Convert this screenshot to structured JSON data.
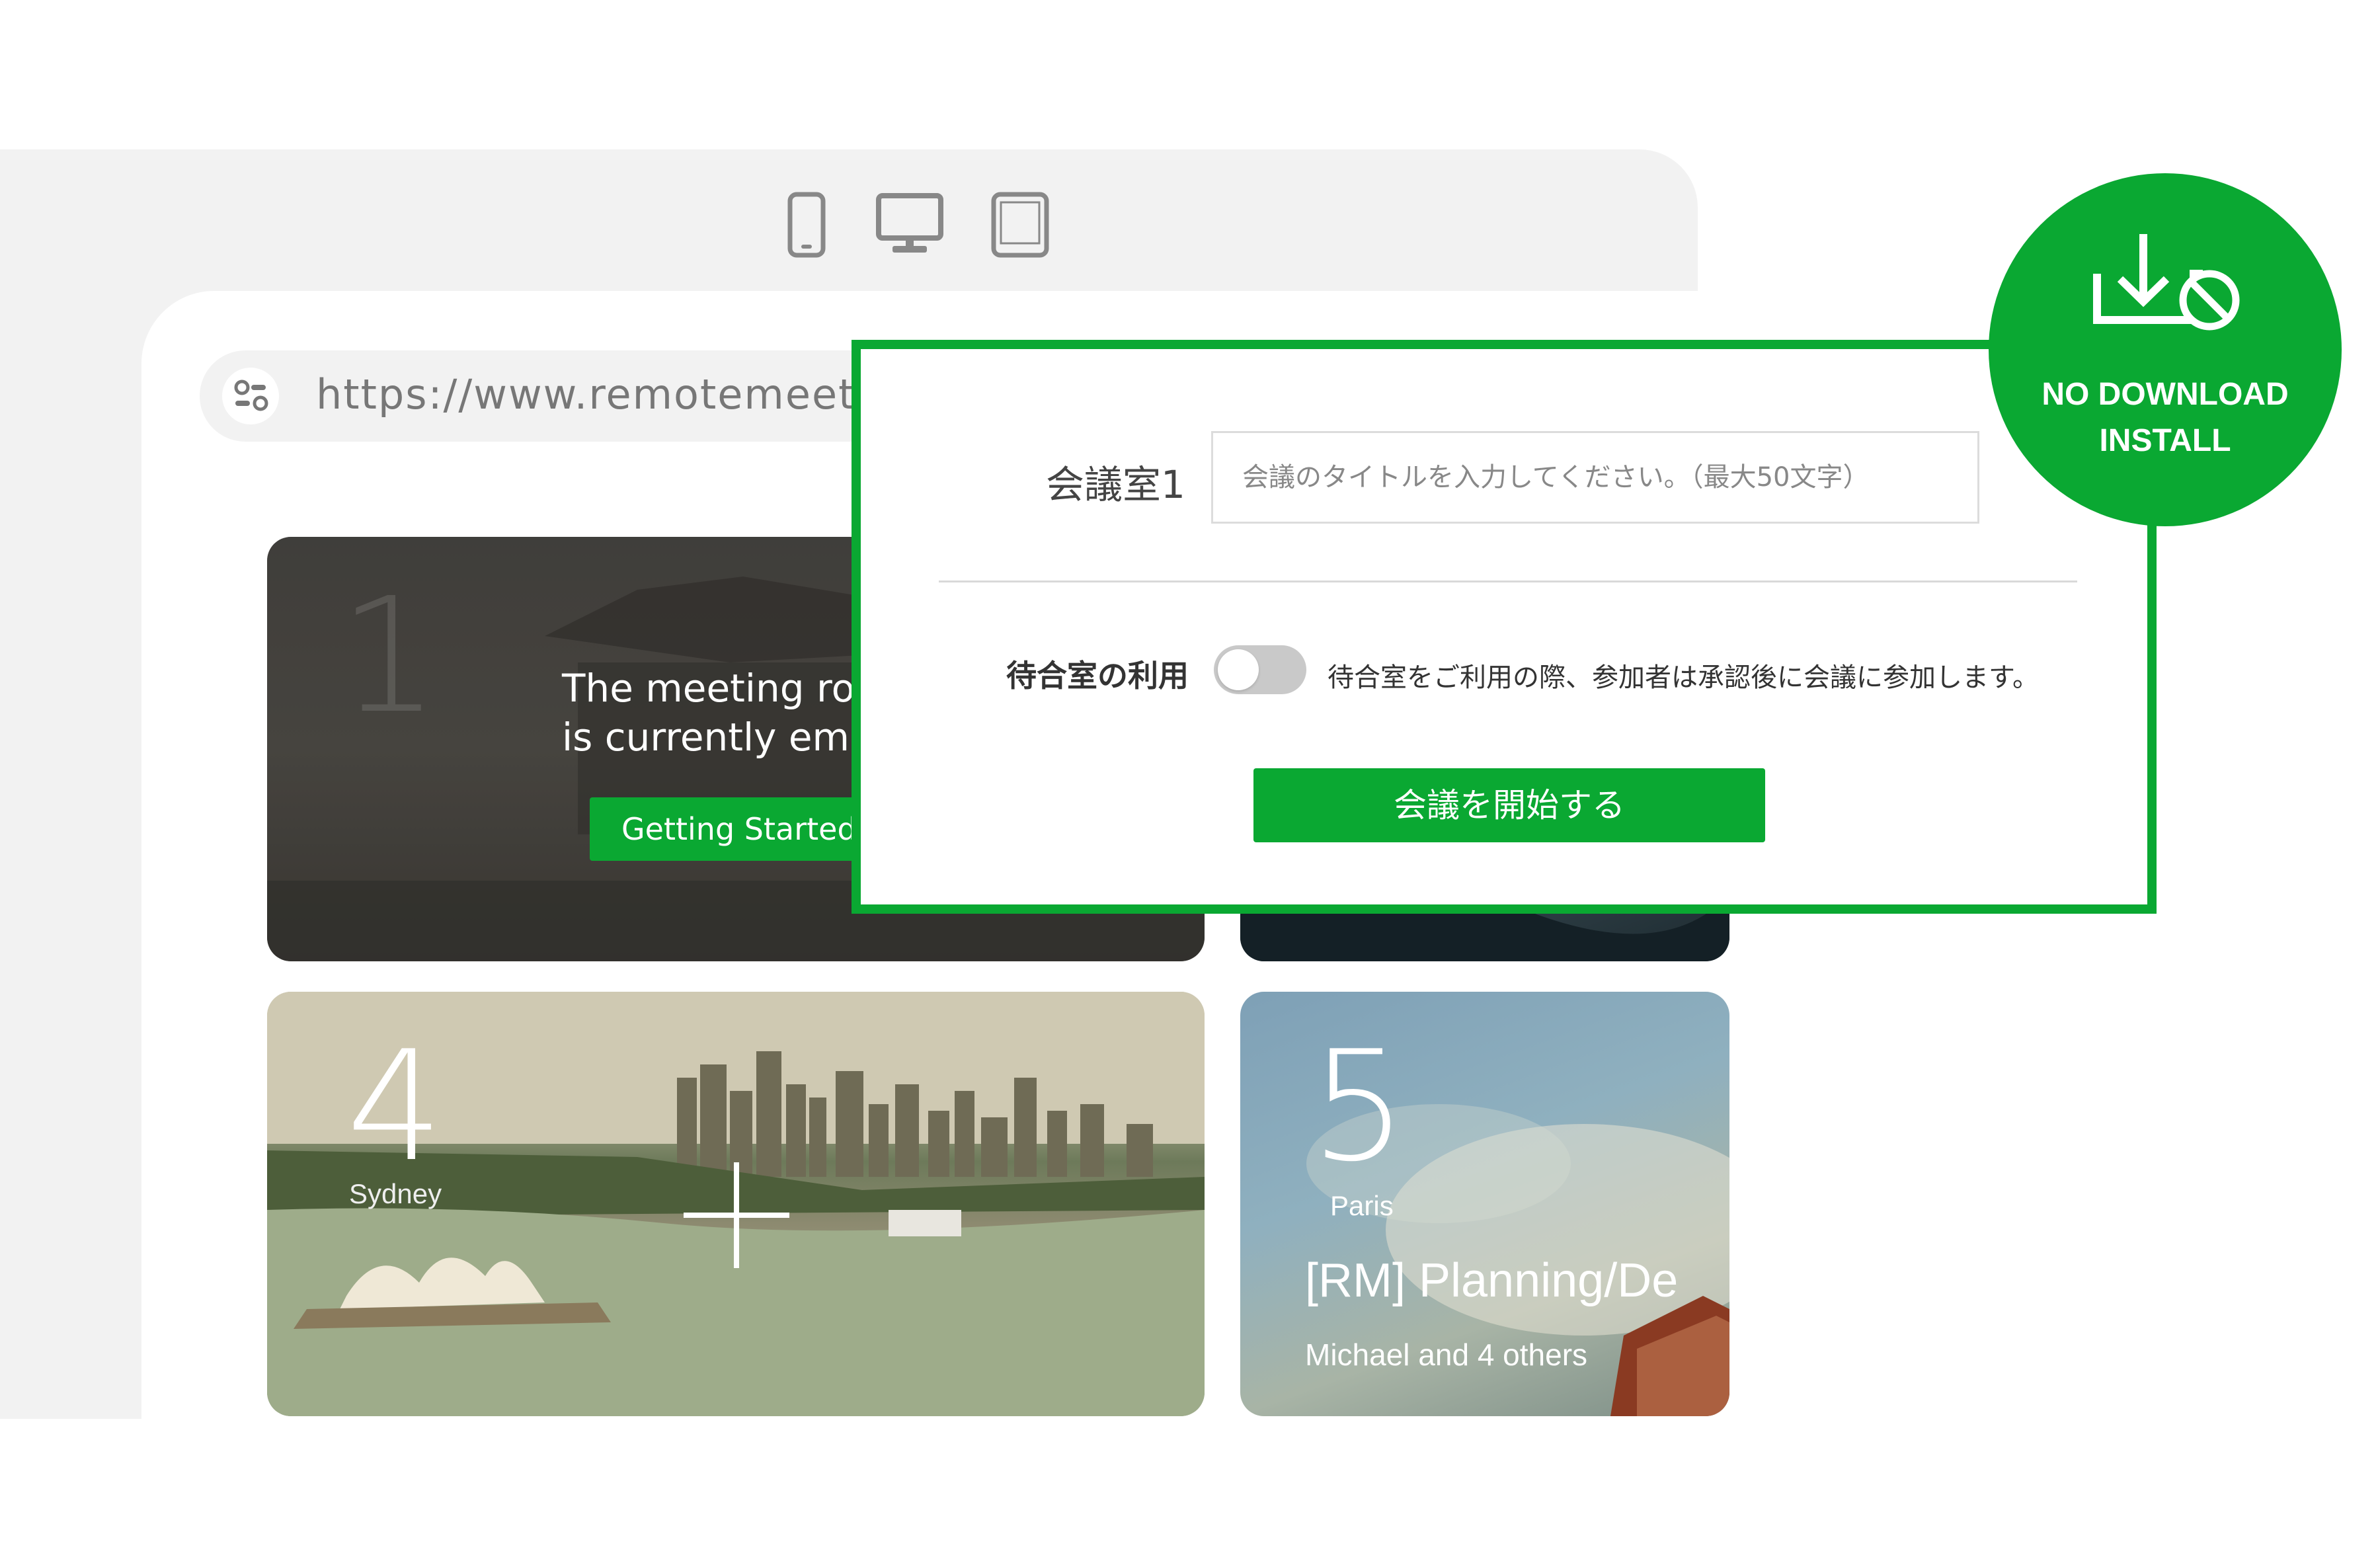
{
  "browser": {
    "url": "https://www.remotemeeti",
    "device_icons": [
      "phone-icon",
      "desktop-icon",
      "tablet-icon"
    ]
  },
  "rooms": {
    "room1": {
      "number": "1",
      "empty_message_line1": "The meeting ro",
      "empty_message_line2": "is currently emp",
      "getting_started_label": "Getting Started"
    },
    "room4": {
      "number": "4",
      "city": "Sydney"
    },
    "room5": {
      "number": "5",
      "city": "Paris",
      "meeting_title": "[RM] Planning/De",
      "participants": "Michael and 4 others"
    }
  },
  "dialog": {
    "room_name_label": "会議室1",
    "title_placeholder": "会議のタイトルを入力してください。（最大50文字）",
    "waiting_room_label": "待合室の利用",
    "waiting_room_enabled": false,
    "waiting_room_description": "待合室をご利用の際、参加者は承認後に会議に参加します。",
    "start_button_label": "会議を開始する"
  },
  "badge": {
    "line1": "NO DOWNLOAD",
    "line2": "INSTALL",
    "icon": "no-download-icon"
  },
  "colors": {
    "accent_green": "#0aa832",
    "frame_gray": "#f2f2f2"
  }
}
